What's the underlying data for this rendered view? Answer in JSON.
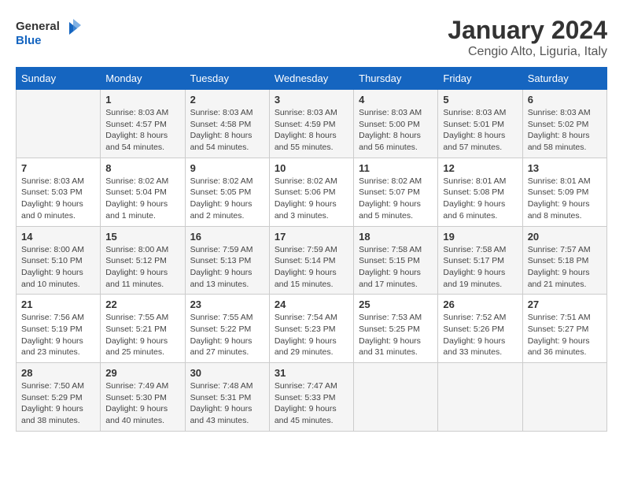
{
  "logo": {
    "line1": "General",
    "line2": "Blue"
  },
  "title": "January 2024",
  "location": "Cengio Alto, Liguria, Italy",
  "days_of_week": [
    "Sunday",
    "Monday",
    "Tuesday",
    "Wednesday",
    "Thursday",
    "Friday",
    "Saturday"
  ],
  "weeks": [
    [
      {
        "day": "",
        "info": ""
      },
      {
        "day": "1",
        "info": "Sunrise: 8:03 AM\nSunset: 4:57 PM\nDaylight: 8 hours\nand 54 minutes."
      },
      {
        "day": "2",
        "info": "Sunrise: 8:03 AM\nSunset: 4:58 PM\nDaylight: 8 hours\nand 54 minutes."
      },
      {
        "day": "3",
        "info": "Sunrise: 8:03 AM\nSunset: 4:59 PM\nDaylight: 8 hours\nand 55 minutes."
      },
      {
        "day": "4",
        "info": "Sunrise: 8:03 AM\nSunset: 5:00 PM\nDaylight: 8 hours\nand 56 minutes."
      },
      {
        "day": "5",
        "info": "Sunrise: 8:03 AM\nSunset: 5:01 PM\nDaylight: 8 hours\nand 57 minutes."
      },
      {
        "day": "6",
        "info": "Sunrise: 8:03 AM\nSunset: 5:02 PM\nDaylight: 8 hours\nand 58 minutes."
      }
    ],
    [
      {
        "day": "7",
        "info": "Sunrise: 8:03 AM\nSunset: 5:03 PM\nDaylight: 9 hours\nand 0 minutes."
      },
      {
        "day": "8",
        "info": "Sunrise: 8:02 AM\nSunset: 5:04 PM\nDaylight: 9 hours\nand 1 minute."
      },
      {
        "day": "9",
        "info": "Sunrise: 8:02 AM\nSunset: 5:05 PM\nDaylight: 9 hours\nand 2 minutes."
      },
      {
        "day": "10",
        "info": "Sunrise: 8:02 AM\nSunset: 5:06 PM\nDaylight: 9 hours\nand 3 minutes."
      },
      {
        "day": "11",
        "info": "Sunrise: 8:02 AM\nSunset: 5:07 PM\nDaylight: 9 hours\nand 5 minutes."
      },
      {
        "day": "12",
        "info": "Sunrise: 8:01 AM\nSunset: 5:08 PM\nDaylight: 9 hours\nand 6 minutes."
      },
      {
        "day": "13",
        "info": "Sunrise: 8:01 AM\nSunset: 5:09 PM\nDaylight: 9 hours\nand 8 minutes."
      }
    ],
    [
      {
        "day": "14",
        "info": "Sunrise: 8:00 AM\nSunset: 5:10 PM\nDaylight: 9 hours\nand 10 minutes."
      },
      {
        "day": "15",
        "info": "Sunrise: 8:00 AM\nSunset: 5:12 PM\nDaylight: 9 hours\nand 11 minutes."
      },
      {
        "day": "16",
        "info": "Sunrise: 7:59 AM\nSunset: 5:13 PM\nDaylight: 9 hours\nand 13 minutes."
      },
      {
        "day": "17",
        "info": "Sunrise: 7:59 AM\nSunset: 5:14 PM\nDaylight: 9 hours\nand 15 minutes."
      },
      {
        "day": "18",
        "info": "Sunrise: 7:58 AM\nSunset: 5:15 PM\nDaylight: 9 hours\nand 17 minutes."
      },
      {
        "day": "19",
        "info": "Sunrise: 7:58 AM\nSunset: 5:17 PM\nDaylight: 9 hours\nand 19 minutes."
      },
      {
        "day": "20",
        "info": "Sunrise: 7:57 AM\nSunset: 5:18 PM\nDaylight: 9 hours\nand 21 minutes."
      }
    ],
    [
      {
        "day": "21",
        "info": "Sunrise: 7:56 AM\nSunset: 5:19 PM\nDaylight: 9 hours\nand 23 minutes."
      },
      {
        "day": "22",
        "info": "Sunrise: 7:55 AM\nSunset: 5:21 PM\nDaylight: 9 hours\nand 25 minutes."
      },
      {
        "day": "23",
        "info": "Sunrise: 7:55 AM\nSunset: 5:22 PM\nDaylight: 9 hours\nand 27 minutes."
      },
      {
        "day": "24",
        "info": "Sunrise: 7:54 AM\nSunset: 5:23 PM\nDaylight: 9 hours\nand 29 minutes."
      },
      {
        "day": "25",
        "info": "Sunrise: 7:53 AM\nSunset: 5:25 PM\nDaylight: 9 hours\nand 31 minutes."
      },
      {
        "day": "26",
        "info": "Sunrise: 7:52 AM\nSunset: 5:26 PM\nDaylight: 9 hours\nand 33 minutes."
      },
      {
        "day": "27",
        "info": "Sunrise: 7:51 AM\nSunset: 5:27 PM\nDaylight: 9 hours\nand 36 minutes."
      }
    ],
    [
      {
        "day": "28",
        "info": "Sunrise: 7:50 AM\nSunset: 5:29 PM\nDaylight: 9 hours\nand 38 minutes."
      },
      {
        "day": "29",
        "info": "Sunrise: 7:49 AM\nSunset: 5:30 PM\nDaylight: 9 hours\nand 40 minutes."
      },
      {
        "day": "30",
        "info": "Sunrise: 7:48 AM\nSunset: 5:31 PM\nDaylight: 9 hours\nand 43 minutes."
      },
      {
        "day": "31",
        "info": "Sunrise: 7:47 AM\nSunset: 5:33 PM\nDaylight: 9 hours\nand 45 minutes."
      },
      {
        "day": "",
        "info": ""
      },
      {
        "day": "",
        "info": ""
      },
      {
        "day": "",
        "info": ""
      }
    ]
  ]
}
